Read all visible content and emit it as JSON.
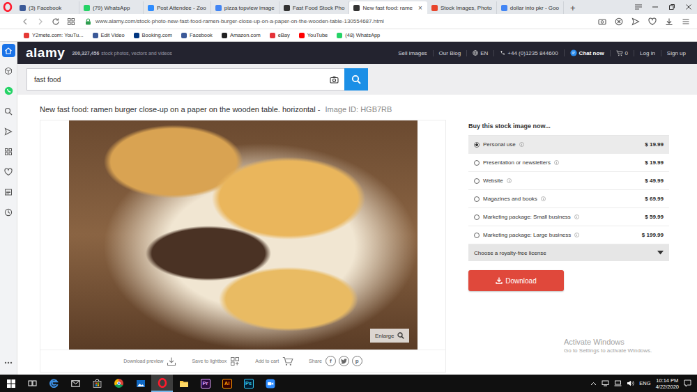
{
  "browser": {
    "tabs": [
      {
        "label": "(3) Facebook",
        "selected": false,
        "color": "#3b5998"
      },
      {
        "label": "(79) WhatsApp",
        "selected": false,
        "color": "#25d366"
      },
      {
        "label": "Post Attendee - Zoo",
        "selected": false,
        "color": "#2d8cff"
      },
      {
        "label": "pizza topview image",
        "selected": false,
        "color": "#4285f4"
      },
      {
        "label": "Fast Food Stock Pho",
        "selected": false,
        "color": "#333333"
      },
      {
        "label": "New fast food: rame",
        "selected": true,
        "color": "#333333"
      },
      {
        "label": "Stock Images, Photo",
        "selected": false,
        "color": "#e8452c"
      },
      {
        "label": "dollar into pkr - Goo",
        "selected": false,
        "color": "#4285f4"
      }
    ],
    "tab_close": "×",
    "new_tab": "+",
    "url": "www.alamy.com/stock-photo-new-fast-food-ramen-burger-close-up-on-a-paper-on-the-wooden-table-130554687.html",
    "bookmarks": [
      {
        "label": "Y2mete.com: YouTu...",
        "color": "#e53935"
      },
      {
        "label": "Edit Video",
        "color": "#3b5998"
      },
      {
        "label": "Booking.com",
        "color": "#003580"
      },
      {
        "label": "Facebook",
        "color": "#3b5998"
      },
      {
        "label": "Amazon.com",
        "color": "#222222"
      },
      {
        "label": "eBay",
        "color": "#e53238"
      },
      {
        "label": "YouTube",
        "color": "#ff0000"
      },
      {
        "label": "(48) WhatsApp",
        "color": "#25d366"
      }
    ]
  },
  "sidebar": [
    {
      "kind": "speed-dial",
      "selected": true
    },
    {
      "kind": "flow",
      "selected": false
    },
    {
      "kind": "whatsapp",
      "selected": false
    },
    {
      "kind": "search",
      "selected": false
    },
    {
      "kind": "send",
      "selected": false
    },
    {
      "kind": "grid",
      "selected": false
    },
    {
      "kind": "heart",
      "selected": false
    },
    {
      "kind": "news",
      "selected": false
    },
    {
      "kind": "history",
      "selected": false
    },
    {
      "kind": "more",
      "selected": false
    }
  ],
  "site": {
    "logo": "alamy",
    "count": "200,327,456",
    "tagline": "stock photos, vectors and videos",
    "nav": [
      {
        "kind": "link",
        "label": "Sell images"
      },
      {
        "kind": "link",
        "label": "Our Blog"
      },
      {
        "kind": "language",
        "label": "EN"
      },
      {
        "kind": "phone",
        "label": "+44 (0)1235 844600"
      },
      {
        "kind": "chat",
        "label": "Chat now"
      },
      {
        "kind": "cart",
        "label": "0"
      },
      {
        "kind": "link",
        "label": "Log in"
      },
      {
        "kind": "link",
        "label": "Sign up"
      }
    ]
  },
  "search": {
    "value": "fast food"
  },
  "image": {
    "title": "New fast food: ramen burger close-up on a paper on the wooden table. horizontal -",
    "id": "Image ID: HGB7RB",
    "enlarge": "Enlarge",
    "actions": [
      {
        "kind": "download",
        "label": "Download preview"
      },
      {
        "kind": "lightbox",
        "label": "Save to lightbox"
      },
      {
        "kind": "cart",
        "label": "Add to cart"
      },
      {
        "kind": "share",
        "label": "Share"
      }
    ],
    "share_icons": [
      {
        "kind": "facebook",
        "glyph": "f"
      },
      {
        "kind": "twitter"
      },
      {
        "kind": "pinterest",
        "glyph": "p"
      }
    ]
  },
  "purchase": {
    "heading": "Buy this stock image now...",
    "options": [
      {
        "label": "Personal use",
        "price": "$ 19.99",
        "selected": true
      },
      {
        "label": "Presentation or newsletters",
        "price": "$ 19.99",
        "selected": false
      },
      {
        "label": "Website",
        "price": "$ 49.99",
        "selected": false
      },
      {
        "label": "Magazines and books",
        "price": "$ 69.99",
        "selected": false
      },
      {
        "label": "Marketing package: Small business",
        "price": "$ 59.99",
        "selected": false
      },
      {
        "label": "Marketing package: Large business",
        "price": "$ 199.99",
        "selected": false
      }
    ],
    "license": "Choose a royalty-free license",
    "download": "Download"
  },
  "watermark": {
    "title": "Activate Windows",
    "subtitle": "Go to Settings to activate Windows."
  },
  "taskbar": {
    "apps": [
      {
        "kind": "start",
        "selected": false
      },
      {
        "kind": "task-view",
        "selected": false
      },
      {
        "kind": "edge",
        "selected": false
      },
      {
        "kind": "mail",
        "selected": false
      },
      {
        "kind": "store",
        "selected": false
      },
      {
        "kind": "chrome",
        "selected": false
      },
      {
        "kind": "photos",
        "selected": false
      },
      {
        "kind": "opera",
        "selected": true
      },
      {
        "kind": "explorer",
        "selected": false
      },
      {
        "kind": "premiere",
        "label": "Pr",
        "selected": false
      },
      {
        "kind": "illustrator",
        "label": "Ai",
        "selected": false
      },
      {
        "kind": "photoshop",
        "label": "Ps",
        "selected": false
      },
      {
        "kind": "zoom",
        "selected": false
      }
    ],
    "language": "ENG",
    "time": "10:14 PM",
    "date": "4/22/2020"
  }
}
